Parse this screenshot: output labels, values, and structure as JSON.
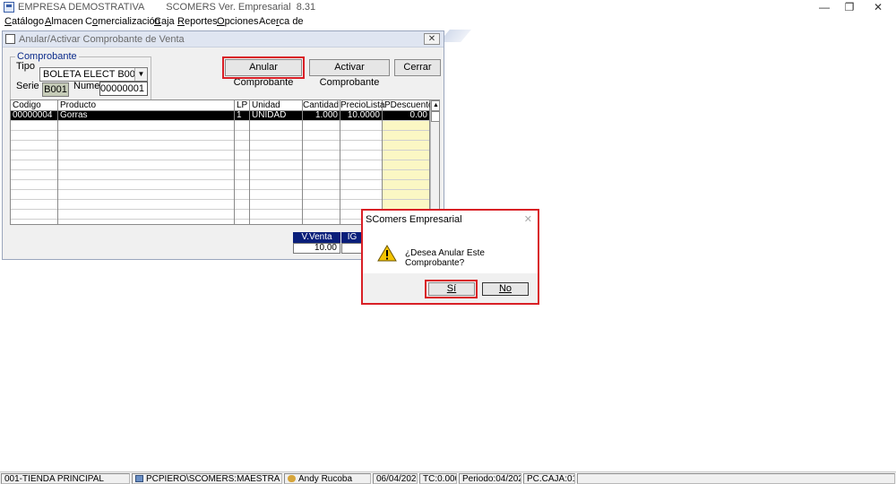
{
  "app": {
    "title": "EMPRESA DEMOSTRATIVA        SCOMERS Ver. Empresarial  8.31",
    "minimize": "—",
    "restore": "❐",
    "close": "✕"
  },
  "menu": [
    {
      "pre": "",
      "ul": "C",
      "post": "atálogo"
    },
    {
      "pre": "",
      "ul": "A",
      "post": "lmacen"
    },
    {
      "pre": "C",
      "ul": "o",
      "post": "mercialización"
    },
    {
      "pre": "",
      "ul": "C",
      "post": "aja"
    },
    {
      "pre": "",
      "ul": "R",
      "post": "eportes"
    },
    {
      "pre": "",
      "ul": "O",
      "post": "pciones"
    },
    {
      "pre": "Ace",
      "ul": "r",
      "post": "ca de"
    }
  ],
  "child": {
    "title": "Anular/Activar Comprobante de Venta",
    "close": "✕",
    "group_label": "Comprobante",
    "tipo_label": "Tipo",
    "tipo_value": "BOLETA ELECT B001",
    "serie_label": "Serie",
    "serie_value": "B001",
    "numero_label": "Numero",
    "numero_value": "00000001",
    "btn_anular": "Anular Comprobante",
    "btn_activar": "Activar Comprobante",
    "btn_cerrar": "Cerrar"
  },
  "grid": {
    "columns": [
      "Codigo",
      "Producto",
      "LP",
      "Unidad",
      "Cantidad",
      "PrecioLista",
      "PDescuento"
    ],
    "rows": [
      [
        "00000004",
        "Gorras",
        "1",
        "UNIDAD",
        "1.000",
        "10.0000",
        "0.00"
      ]
    ]
  },
  "totals": {
    "v_venta_label": "V.Venta",
    "v_venta_value": "10.00",
    "ig_label": "IG"
  },
  "dialog": {
    "title": "SComers Empresarial",
    "close": "✕",
    "message": "¿Desea Anular Este Comprobante?",
    "yes": "Sí",
    "no": "No"
  },
  "status": {
    "store": "001-TIENDA PRINCIPAL",
    "db": "PCPIERO\\SCOMERS:MAESTRA",
    "user": "Andy Rucoba",
    "date": "06/04/2020",
    "tc": "TC:0.000",
    "periodo": "Periodo:04/2020",
    "caja": "PC.CAJA:01"
  },
  "colors": {
    "accent_red": "#d91f26",
    "header_blue": "#0a1f7a",
    "selected_row": "#000000",
    "discount_column": "#fbf7c4"
  }
}
